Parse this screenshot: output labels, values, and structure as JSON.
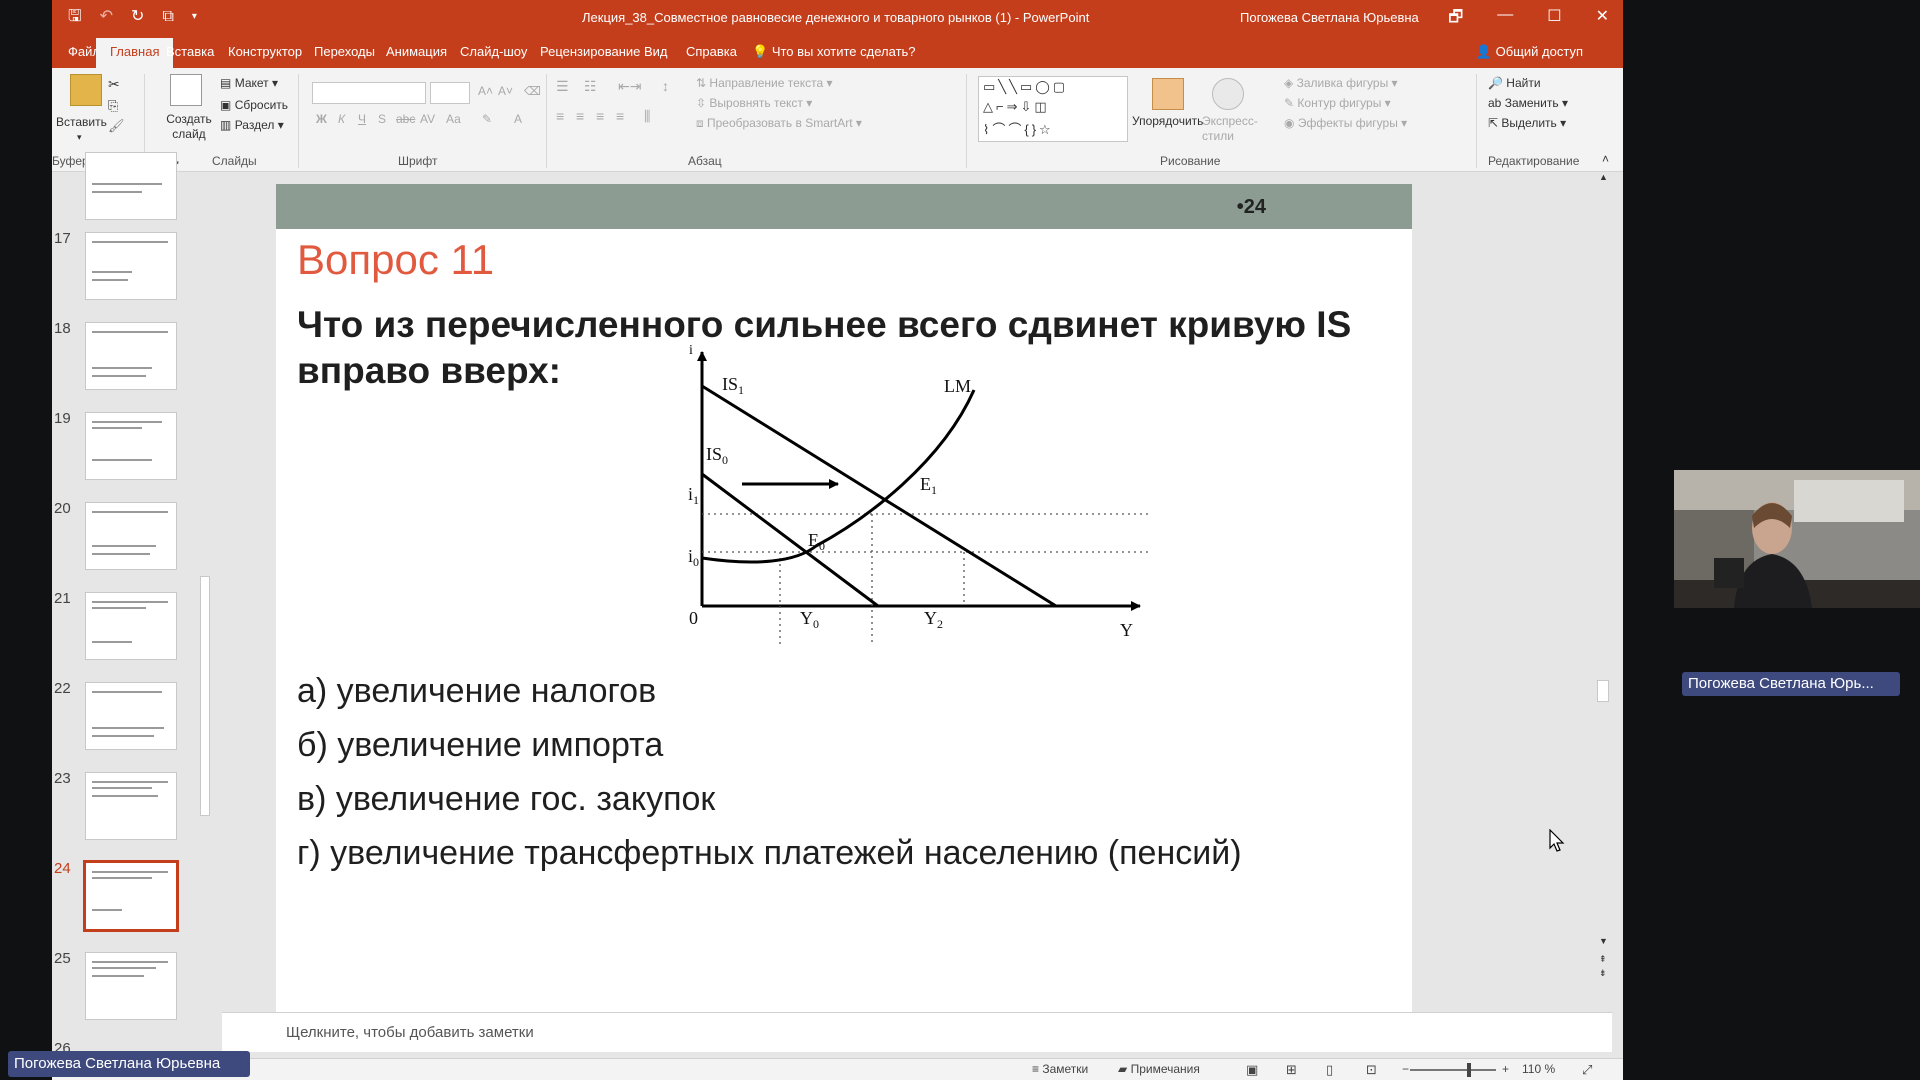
{
  "window": {
    "title": "Лекция_38_Совместное равновесие денежного и товарного рынков (1)  -  PowerPoint",
    "user": "Погожева Светлана Юрьевна",
    "controls": [
      "🗗",
      "—",
      "☐",
      "✕"
    ]
  },
  "tabs": [
    "Файл",
    "Главная",
    "Вставка",
    "Конструктор",
    "Переходы",
    "Анимация",
    "Слайд-шоу",
    "Рецензирование",
    "Вид",
    "Справка"
  ],
  "tell_me": "Что вы хотите сделать?",
  "share": "Общий доступ",
  "ribbon": {
    "clipboard": {
      "paste": "Вставить",
      "label": "Буфер обмена"
    },
    "slides": {
      "new_slide": "Создать слайд",
      "layout": "Макет",
      "reset": "Сбросить",
      "section": "Раздел",
      "label": "Слайды"
    },
    "font": {
      "label": "Шрифт",
      "bold": "Ж",
      "italic": "К",
      "underline": "Ч",
      "shadow": "S",
      "strike": "abc",
      "case": "Аа",
      "color": "А"
    },
    "paragraph": {
      "label": "Абзац",
      "text_direction": "Направление текста",
      "align_text": "Выровнять текст",
      "smartart": "Преобразовать в SmartArt"
    },
    "drawing": {
      "label": "Рисование",
      "arrange": "Упорядочить",
      "quick_styles": "Экспресс-стили",
      "fill": "Заливка фигуры",
      "outline": "Контур фигуры",
      "effects": "Эффекты фигуры"
    },
    "editing": {
      "label": "Редактирование",
      "find": "Найти",
      "replace": "Заменить",
      "select": "Выделить"
    }
  },
  "thumbnails": [
    {
      "num": "17",
      "active": false
    },
    {
      "num": "18",
      "active": false
    },
    {
      "num": "19",
      "active": false
    },
    {
      "num": "20",
      "active": false
    },
    {
      "num": "21",
      "active": false
    },
    {
      "num": "22",
      "active": false
    },
    {
      "num": "23",
      "active": false
    },
    {
      "num": "24",
      "active": true
    },
    {
      "num": "25",
      "active": false
    },
    {
      "num": "26",
      "active": false
    }
  ],
  "slide": {
    "number": "•24",
    "title": "Вопрос 11",
    "question": "Что из перечисленного сильнее всего сдвинет кривую IS вправо вверх:",
    "graph_labels": {
      "y_axis": "i",
      "x_axis": "Y",
      "origin": "0",
      "is1": "IS",
      "is1_sub": "1",
      "is0": "IS",
      "is0_sub": "0",
      "lm": "LM",
      "e1": "E",
      "e1_sub": "1",
      "e0": "E",
      "e0_sub": "0",
      "i1": "i",
      "i1_sub": "1",
      "i0": "i",
      "i0_sub": "0",
      "y0": "Y",
      "y0_sub": "0",
      "y2": "Y",
      "y2_sub": "2"
    },
    "answers": [
      "а) увеличение налогов",
      "б) увеличение импорта",
      "в) увеличение гос. закупок",
      "г) увеличение трансфертных платежей населению (пенсий)"
    ]
  },
  "notes_placeholder": "Щелкните, чтобы добавить заметки",
  "status": {
    "notes": "Заметки",
    "comments": "Примечания",
    "zoom": "110 %"
  },
  "participant_label": "Погожева Светлана Юрь...",
  "host_label": "Погожева Светлана Юрьевна",
  "colors": {
    "accent": "#c43e1c",
    "slide_header": "#8c9c93",
    "title_red": "#e1593e",
    "name_tag": "#3e4a7e"
  }
}
